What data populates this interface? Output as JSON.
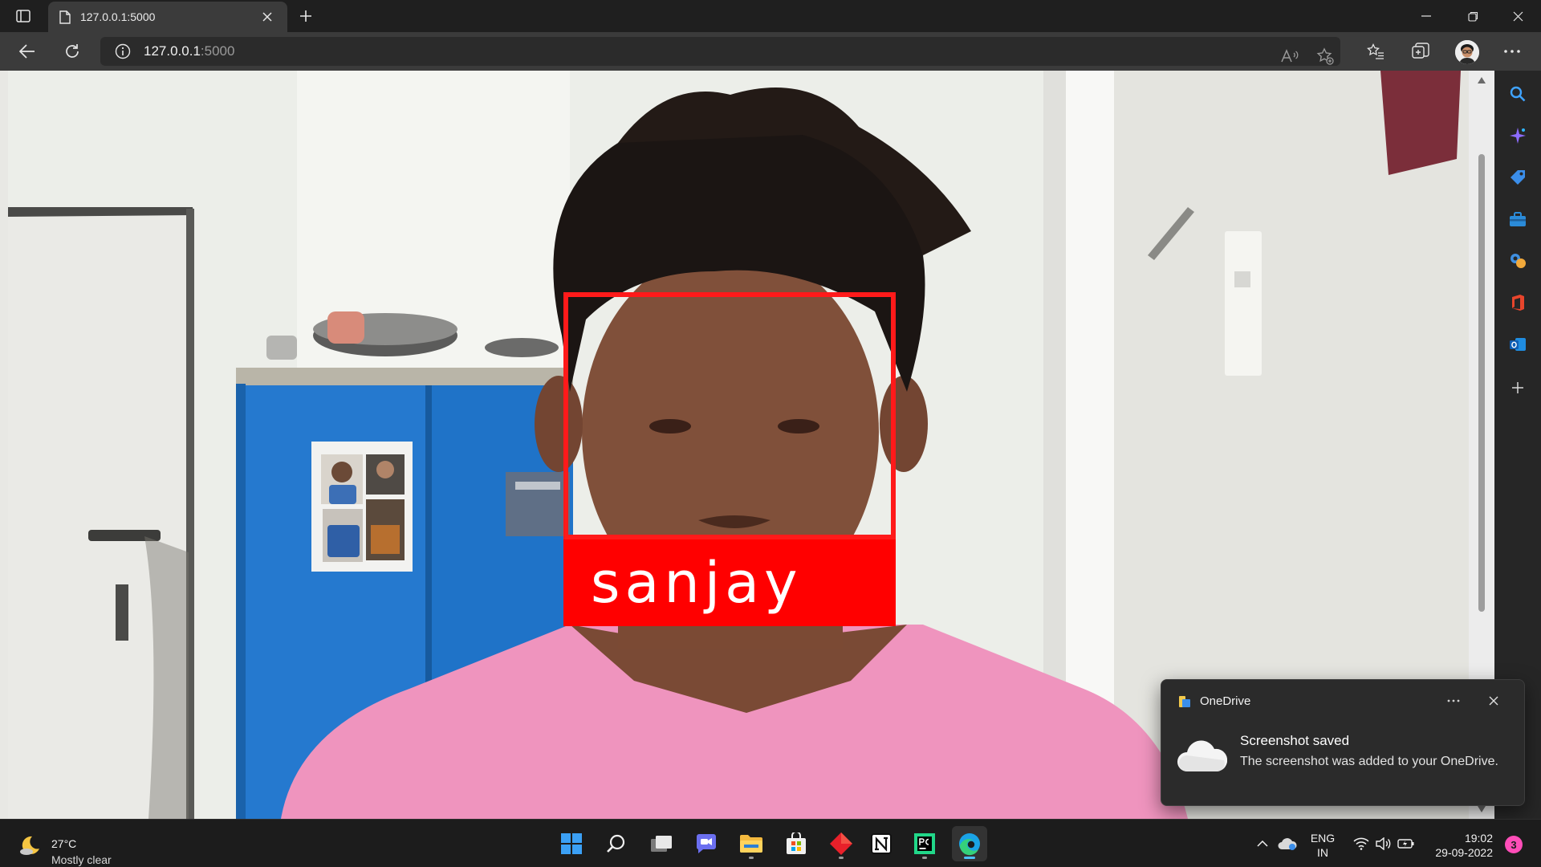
{
  "browser": {
    "tab": {
      "title": "127.0.0.1:5000"
    },
    "address": {
      "host": "127.0.0.1",
      "port": ":5000"
    }
  },
  "page": {
    "detected_name": "sanjay",
    "detection_color": "#ff0000"
  },
  "sidebar": {
    "items": [
      "search-icon",
      "copilot-icon",
      "shopping-tag-icon",
      "tools-icon",
      "games-icon",
      "office-icon",
      "outlook-icon",
      "add-icon"
    ]
  },
  "toast": {
    "app": "OneDrive",
    "title": "Screenshot saved",
    "body": "The screenshot was added to your OneDrive."
  },
  "taskbar": {
    "weather": {
      "temp": "27°C",
      "condition": "Mostly clear"
    },
    "apps": [
      "start-icon",
      "search-icon",
      "task-view-icon",
      "teams-chat-icon",
      "file-explorer-icon",
      "microsoft-store-icon",
      "git-icon",
      "notion-icon",
      "pycharm-icon",
      "edge-icon"
    ],
    "language": {
      "line1": "ENG",
      "line2": "IN"
    },
    "clock": {
      "time": "19:02",
      "date": "29-09-2022"
    },
    "notifications": "3"
  }
}
